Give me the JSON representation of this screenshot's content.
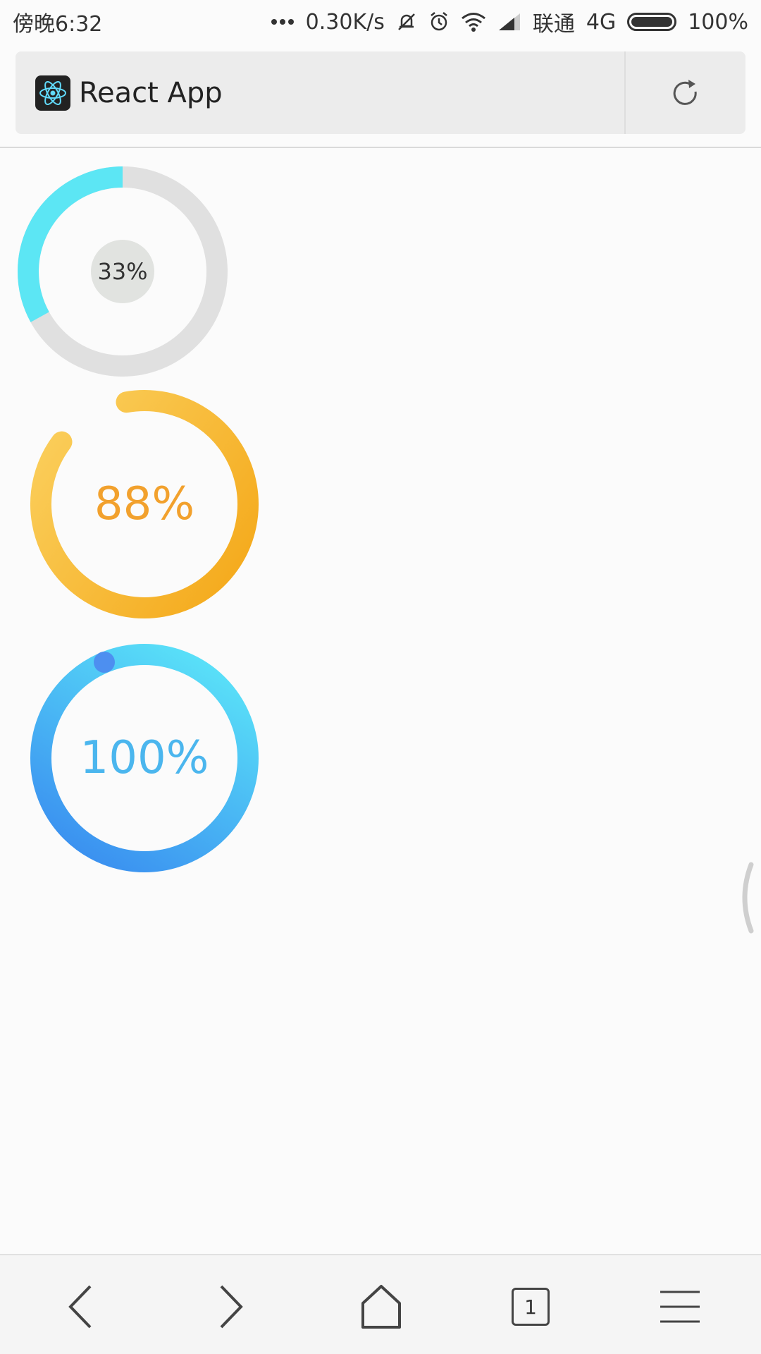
{
  "status_bar": {
    "time": "傍晚6:32",
    "network_speed": "0.30K/s",
    "carrier": "联通",
    "network_type": "4G",
    "battery": "100%",
    "icons": [
      "more-dots-icon",
      "bell-off-icon",
      "alarm-icon",
      "wifi-icon",
      "signal-icon",
      "battery-icon"
    ]
  },
  "browser": {
    "page_title": "React App",
    "favicon": "react-logo-icon",
    "reload_icon": "reload-icon"
  },
  "progress_rings": [
    {
      "label": "33%",
      "value": 33,
      "color": "#5ce6f4",
      "track": "#e0e0e0"
    },
    {
      "label": "88%",
      "value": 88,
      "color": "#f8c248",
      "gradient_to": "#f4a717",
      "text_color": "#f2a12d"
    },
    {
      "label": "100%",
      "value": 100,
      "color": "#55d8f8",
      "gradient_to": "#3a8ff0",
      "text_color": "#4bb6ee"
    }
  ],
  "bottom_nav": {
    "tab_count": "1",
    "icons": [
      "back-arrow-icon",
      "forward-arrow-icon",
      "home-icon",
      "tabs-icon",
      "menu-icon"
    ]
  }
}
